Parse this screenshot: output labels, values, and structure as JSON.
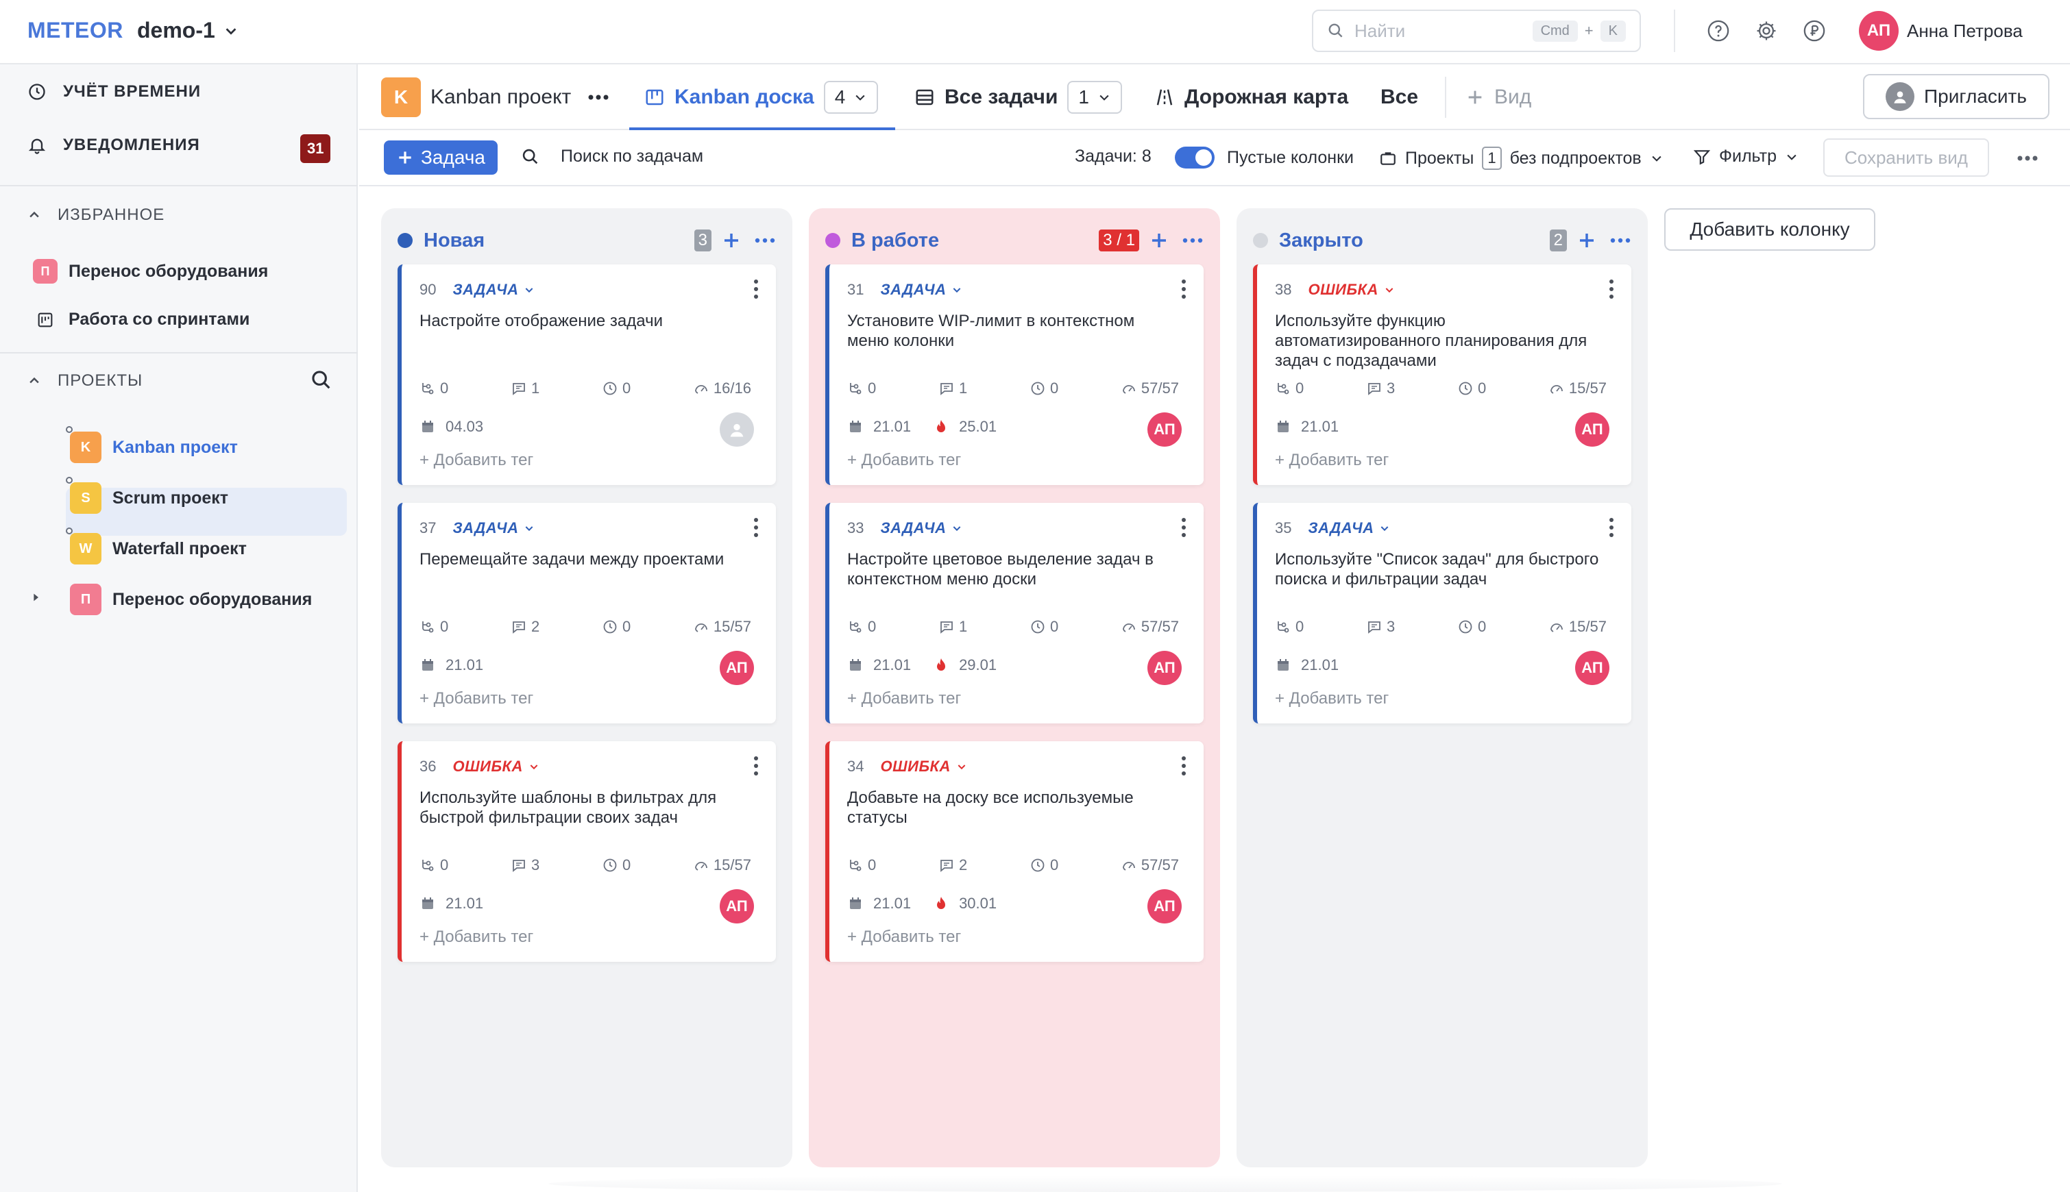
{
  "topbar": {
    "logo": "METEOR",
    "workspace": "demo-1",
    "search_placeholder": "Найти",
    "shortcut_key1": "Cmd",
    "shortcut_plus": "+",
    "shortcut_key2": "K",
    "user_initials": "АП",
    "user_name": "Анна Петрова"
  },
  "sidebar": {
    "time_tracking": "УЧЁТ ВРЕМЕНИ",
    "notifications": "УВЕДОМЛЕНИЯ",
    "notifications_count": "31",
    "favorites_label": "ИЗБРАННОЕ",
    "favorites": [
      {
        "icon_letter": "П",
        "label": "Перенос оборудования"
      },
      {
        "label": "Работа со спринтами"
      }
    ],
    "projects_label": "ПРОЕКТЫ",
    "projects": [
      {
        "icon_letter": "K",
        "label": "Kanban проект",
        "color": "#f7a04c"
      },
      {
        "icon_letter": "S",
        "label": "Scrum проект",
        "color": "#f5c542"
      },
      {
        "icon_letter": "W",
        "label": "Waterfall проект",
        "color": "#f5c542"
      },
      {
        "icon_letter": "П",
        "label": "Перенос оборудования",
        "color": "#f27c91"
      }
    ]
  },
  "tabs": {
    "project_letter": "K",
    "project_name": "Kanban проект",
    "kanban_board": "Kanban доска",
    "kanban_count": "4",
    "all_tasks": "Все задачи",
    "all_tasks_count": "1",
    "roadmap": "Дорожная карта",
    "all": "Все",
    "add_view": "Вид",
    "invite": "Пригласить"
  },
  "toolbar": {
    "add_task": "Задача",
    "search_tasks": "Поиск по задачам",
    "tasks_count": "Задачи: 8",
    "empty_columns": "Пустые колонки",
    "projects_label": "Проекты",
    "projects_count": "1",
    "subprojects": "без подпроектов",
    "filter": "Фильтр",
    "save_view": "Сохранить вид"
  },
  "board": {
    "add_column": "Добавить колонку",
    "columns": [
      {
        "title": "Новая",
        "count": "3",
        "dot_color": "#2f5fb8",
        "count_bg": "#9aa0a9",
        "cards": [
          {
            "num": "90",
            "type": "ЗАДАЧА",
            "title": "Настройте отображение задачи",
            "subtasks": "0",
            "comments": "1",
            "time": "0",
            "progress": "16/16",
            "date": "04.03",
            "deadline": "",
            "avatar": "",
            "tag": "+ Добавить тег"
          },
          {
            "num": "37",
            "type": "ЗАДАЧА",
            "title": "Перемещайте задачи между проектами",
            "subtasks": "0",
            "comments": "2",
            "time": "0",
            "progress": "15/57",
            "date": "21.01",
            "deadline": "",
            "avatar": "АП",
            "tag": "+ Добавить тег"
          },
          {
            "num": "36",
            "type": "ОШИБКА",
            "title": "Используйте шаблоны в фильтрах для быстрой фильтрации своих задач",
            "subtasks": "0",
            "comments": "3",
            "time": "0",
            "progress": "15/57",
            "date": "21.01",
            "deadline": "",
            "avatar": "АП",
            "tag": "+ Добавить тег"
          }
        ]
      },
      {
        "title": "В работе",
        "count": "3 / 1",
        "dot_color": "#c05bdc",
        "count_bg": "#e03131",
        "cards": [
          {
            "num": "31",
            "type": "ЗАДАЧА",
            "title": "Установите WIP-лимит в контекстном меню колонки",
            "subtasks": "0",
            "comments": "1",
            "time": "0",
            "progress": "57/57",
            "date": "21.01",
            "deadline": "25.01",
            "avatar": "АП",
            "tag": "+ Добавить тег"
          },
          {
            "num": "33",
            "type": "ЗАДАЧА",
            "title": "Настройте цветовое выделение задач в контекстном меню доски",
            "subtasks": "0",
            "comments": "1",
            "time": "0",
            "progress": "57/57",
            "date": "21.01",
            "deadline": "29.01",
            "avatar": "АП",
            "tag": "+ Добавить тег"
          },
          {
            "num": "34",
            "type": "ОШИБКА",
            "title": "Добавьте на доску все используемые статусы",
            "subtasks": "0",
            "comments": "2",
            "time": "0",
            "progress": "57/57",
            "date": "21.01",
            "deadline": "30.01",
            "avatar": "АП",
            "tag": "+ Добавить тег"
          }
        ]
      },
      {
        "title": "Закрыто",
        "count": "2",
        "dot_color": "#d5d8dd",
        "count_bg": "#9aa0a9",
        "cards": [
          {
            "num": "38",
            "type": "ОШИБКА",
            "title": "Используйте функцию автоматизированного планирования для задач с подзадачами",
            "subtasks": "0",
            "comments": "3",
            "time": "0",
            "progress": "15/57",
            "date": "21.01",
            "deadline": "",
            "avatar": "АП",
            "tag": "+ Добавить тег"
          },
          {
            "num": "35",
            "type": "ЗАДАЧА",
            "title": "Используйте \"Список задач\" для быстрого поиска и фильтрации задач",
            "subtasks": "0",
            "comments": "3",
            "time": "0",
            "progress": "15/57",
            "date": "21.01",
            "deadline": "",
            "avatar": "АП",
            "tag": "+ Добавить тег"
          }
        ]
      }
    ]
  }
}
